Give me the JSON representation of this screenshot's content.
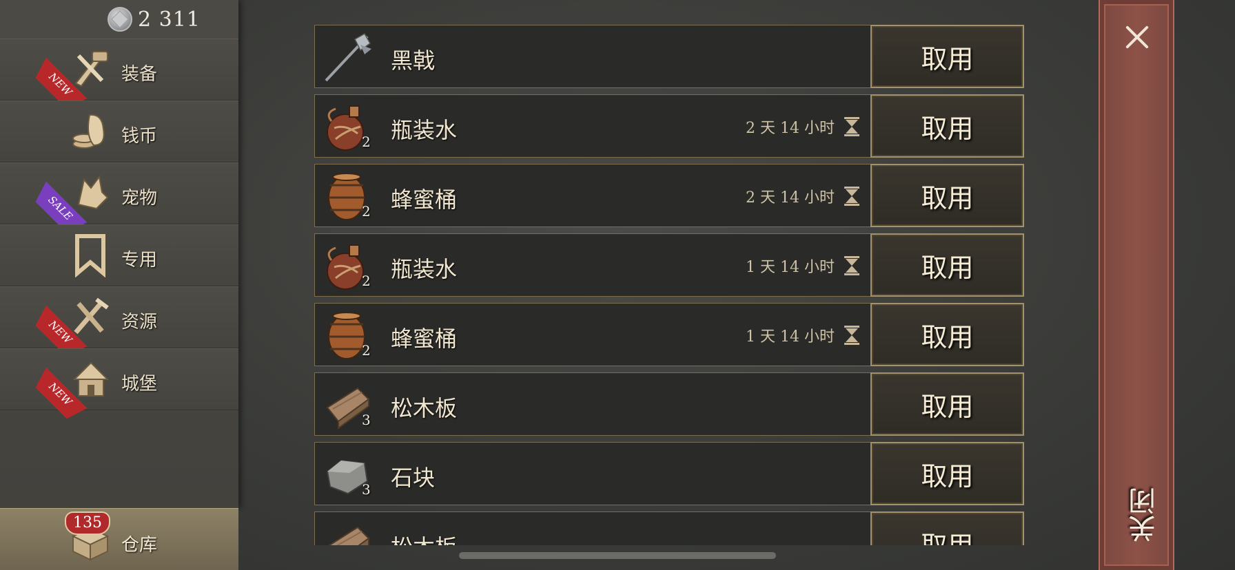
{
  "currency": {
    "icon": "silver-coin-icon",
    "value": "2 311"
  },
  "sidebar": {
    "items": [
      {
        "label": "装备",
        "icon": "equipment-icon",
        "ribbon": "NEW",
        "ribbon_type": "new"
      },
      {
        "label": "钱币",
        "icon": "coins-icon",
        "ribbon": "",
        "ribbon_type": ""
      },
      {
        "label": "宠物",
        "icon": "pet-icon",
        "ribbon": "SALE",
        "ribbon_type": "sale"
      },
      {
        "label": "专用",
        "icon": "bookmark-icon",
        "ribbon": "",
        "ribbon_type": ""
      },
      {
        "label": "资源",
        "icon": "resources-icon",
        "ribbon": "NEW",
        "ribbon_type": "new"
      },
      {
        "label": "城堡",
        "icon": "castle-icon",
        "ribbon": "NEW",
        "ribbon_type": "new"
      }
    ],
    "storage": {
      "label": "仓库",
      "badge": "135",
      "icon": "storage-box-icon"
    }
  },
  "items": [
    {
      "name": "黑戟",
      "count": "",
      "timer": "",
      "icon": "halberd",
      "button": "取用"
    },
    {
      "name": "瓶装水",
      "count": "2",
      "timer": "2 天 14 小时",
      "icon": "flask",
      "button": "取用"
    },
    {
      "name": "蜂蜜桶",
      "count": "2",
      "timer": "2 天 14 小时",
      "icon": "barrel",
      "button": "取用"
    },
    {
      "name": "瓶装水",
      "count": "2",
      "timer": "1 天 14 小时",
      "icon": "flask",
      "button": "取用"
    },
    {
      "name": "蜂蜜桶",
      "count": "2",
      "timer": "1 天 14 小时",
      "icon": "barrel",
      "button": "取用"
    },
    {
      "name": "松木板",
      "count": "3",
      "timer": "",
      "icon": "plank",
      "button": "取用"
    },
    {
      "name": "石块",
      "count": "3",
      "timer": "",
      "icon": "stone",
      "button": "取用"
    },
    {
      "name": "松木板",
      "count": "",
      "timer": "",
      "icon": "plank",
      "button": "取用"
    }
  ],
  "close": {
    "label": "关闭"
  },
  "colors": {
    "ribbon_new": "#b8282a",
    "ribbon_sale": "#7a3fbf",
    "close_panel": "#8d5248",
    "button_border": "#a4926b"
  }
}
